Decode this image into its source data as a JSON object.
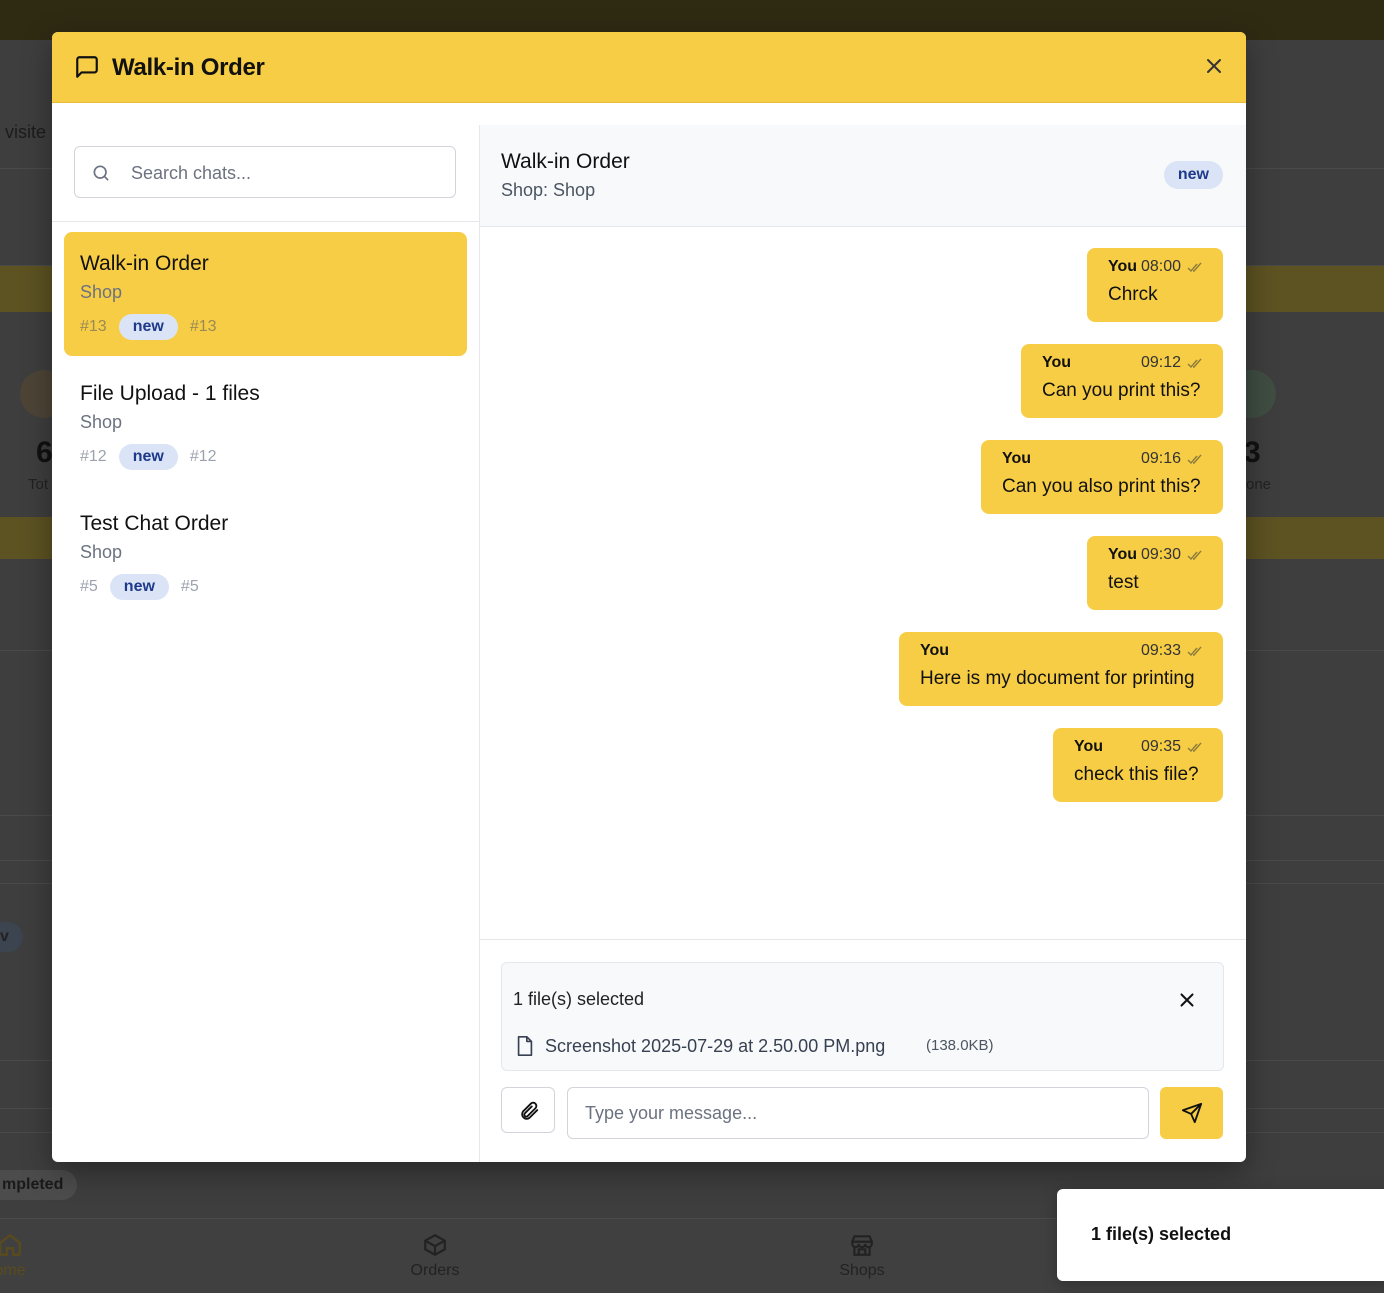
{
  "background": {
    "visited_fragment": "r visite",
    "stat_left_value": "6",
    "stat_left_label": "Tot",
    "stat_right_value": "3",
    "stat_right_label": "one",
    "status_fragment": "mpleted",
    "row_badge_fragment": "v",
    "nav": {
      "home": "ome",
      "orders": "Orders",
      "shops": "Shops"
    }
  },
  "modal": {
    "title": "Walk-in Order",
    "header_icon": "message-square-icon",
    "close_icon": "x-icon"
  },
  "sidebar": {
    "search_placeholder": "Search chats...",
    "chats": [
      {
        "title": "Walk-in Order",
        "shop": "Shop",
        "num": "#13",
        "badge": "new",
        "num2": "#13",
        "active": true
      },
      {
        "title": "File Upload - 1 files",
        "shop": "Shop",
        "num": "#12",
        "badge": "new",
        "num2": "#12",
        "active": false
      },
      {
        "title": "Test Chat Order",
        "shop": "Shop",
        "num": "#5",
        "badge": "new",
        "num2": "#5",
        "active": false
      }
    ]
  },
  "chat": {
    "title": "Walk-in Order",
    "subtitle": "Shop: Shop",
    "badge": "new",
    "messages": [
      {
        "sender": "You",
        "time": "08:00",
        "text": "Chrck"
      },
      {
        "sender": "You",
        "time": "09:12",
        "text": "Can you print this?"
      },
      {
        "sender": "You",
        "time": "09:16",
        "text": "Can you also print this?"
      },
      {
        "sender": "You",
        "time": "09:30",
        "text": "test"
      },
      {
        "sender": "You",
        "time": "09:33",
        "text": "Here is my document for printing"
      },
      {
        "sender": "You",
        "time": "09:35",
        "text": "check this file?"
      }
    ]
  },
  "composer": {
    "files_selected": "1 file(s) selected",
    "file_name": "Screenshot 2025-07-29 at 2.50.00 PM.png",
    "file_size": "(138.0KB)",
    "input_placeholder": "Type your message..."
  },
  "toast": {
    "text": "1 file(s) selected"
  },
  "colors": {
    "accent": "#f7cd45",
    "badge_bg": "#dbe4f6",
    "badge_text": "#1e3a8a"
  }
}
